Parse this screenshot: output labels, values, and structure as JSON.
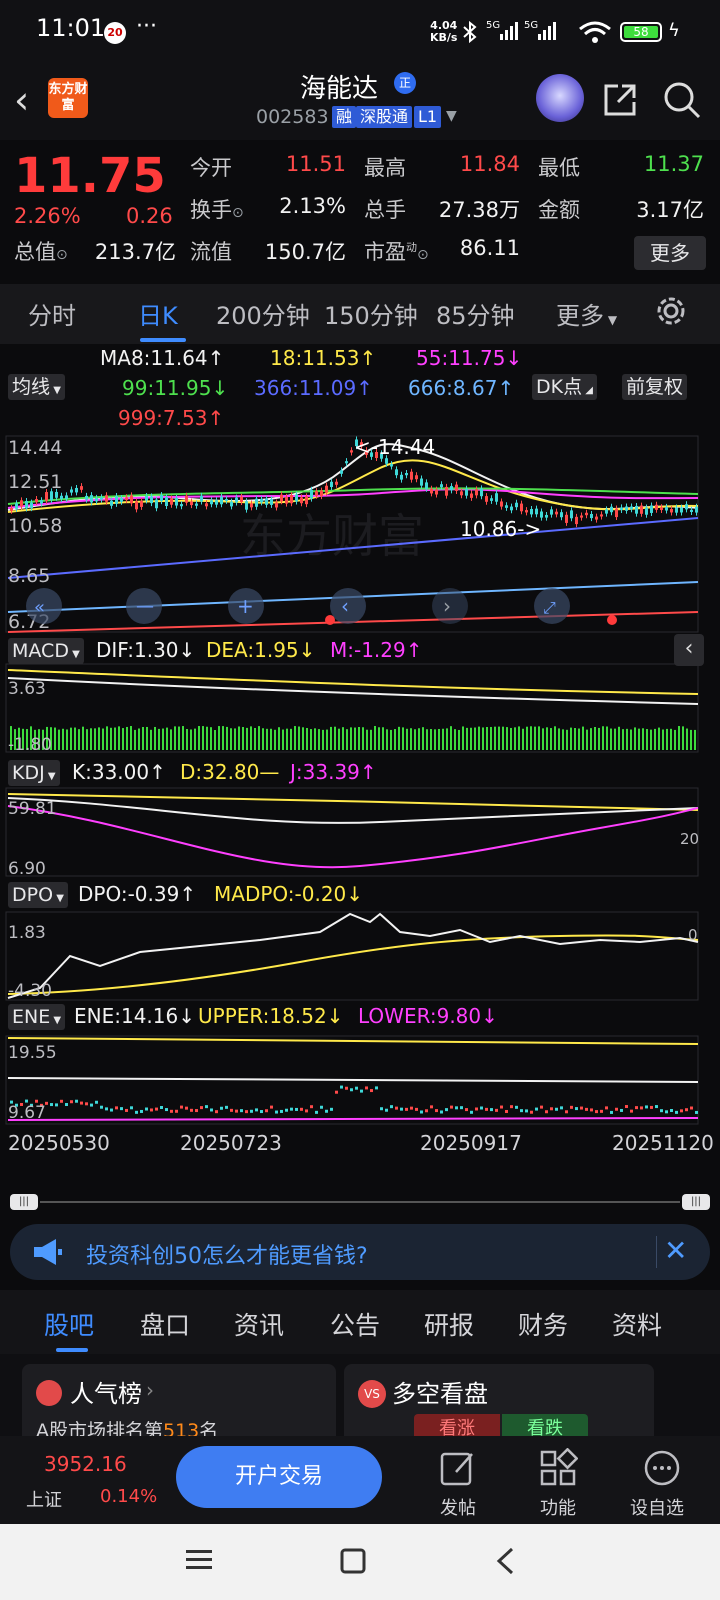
{
  "status": {
    "time": "11:01",
    "notif_badge": "20",
    "more": "···",
    "speed_top": "4.04",
    "speed_bottom": "KB/s",
    "network": "5G 5G",
    "battery": "58"
  },
  "header": {
    "app_logo": "东方财富",
    "stock_name": "海能达",
    "name_badge": "正",
    "stock_code": "002583",
    "tags": [
      "融",
      "深股通",
      "L1"
    ]
  },
  "quote": {
    "price": "11.75",
    "pct": "2.26%",
    "change": "0.26",
    "open_label": "今开",
    "open": "11.51",
    "high_label": "最高",
    "high": "11.84",
    "low_label": "最低",
    "low": "11.37",
    "turnover_label": "换手",
    "turnover": "2.13%",
    "volume_label": "总手",
    "volume": "27.38万",
    "amount_label": "金额",
    "amount": "3.17亿",
    "mcap_label": "总值",
    "mcap": "213.7亿",
    "float_label": "流值",
    "float": "150.7亿",
    "pe_label": "市盈",
    "pe_sup": "动",
    "pe": "86.11",
    "more_button": "更多"
  },
  "chart_tabs": [
    "分时",
    "日K",
    "200分钟",
    "150分钟",
    "85分钟",
    "更多"
  ],
  "main_chart": {
    "indicator_button": "均线",
    "ma_lines": [
      {
        "text": "MA8:11.64↑",
        "color": "#f2f2f2"
      },
      {
        "text": "18:11.53↑",
        "color": "#ffe94a"
      },
      {
        "text": "55:11.75↓",
        "color": "#ff40ff"
      },
      {
        "text": "99:11.95↓",
        "color": "#4ee04e"
      },
      {
        "text": "366:11.09↑",
        "color": "#5b6bff"
      },
      {
        "text": "666:8.67↑",
        "color": "#6fb6ff"
      },
      {
        "text": "999:7.53↑",
        "color": "#ff4a4a"
      }
    ],
    "dk_button": "DK点",
    "adjust_button": "前复权",
    "y_labels": [
      "14.44",
      "12.51",
      "10.58",
      "8.65",
      "6.72"
    ],
    "max_marker": "<-14.44",
    "min_marker": "10.86->",
    "watermark": "东方财富"
  },
  "macd": {
    "button": "MACD",
    "dif": "DIF:1.30↓",
    "dea": "DEA:1.95↓",
    "m": "M:-1.29↑",
    "y_top": "3.63",
    "y_bottom": "-1.80"
  },
  "kdj": {
    "button": "KDJ",
    "k": "K:33.00↑",
    "d": "D:32.80—",
    "j": "J:33.39↑",
    "y_top": "59.81",
    "y_bottom": "6.90",
    "y_right": "20"
  },
  "dpo": {
    "button": "DPO",
    "dpo": "DPO:-0.39↑",
    "madpo": "MADPO:-0.20↓",
    "y_top": "1.83",
    "y_bottom": "-4.30",
    "y_right": "0"
  },
  "ene": {
    "button": "ENE",
    "ene": "ENE:14.16↓",
    "upper": "UPPER:18.52↓",
    "lower": "LOWER:9.80↓",
    "y_top": "19.55",
    "y_bottom": "9.67"
  },
  "dates": [
    "20250530",
    "20250723",
    "20250917",
    "20251120"
  ],
  "banner": {
    "text": "投资科创50怎么才能更省钱?"
  },
  "info_tabs": [
    "股吧",
    "盘口",
    "资讯",
    "公告",
    "研报",
    "财务",
    "资料"
  ],
  "cards": {
    "left_title": "人气榜",
    "left_sub_prefix": "A股市场排名第",
    "left_rank": "513",
    "left_sub_suffix": "名",
    "right_title": "多空看盘",
    "bull": "看涨",
    "bear": "看跌"
  },
  "bottom_bar": {
    "index_value": "3952.16",
    "index_name": "上证",
    "index_pct": "0.14%",
    "trade_button": "开户交易",
    "post": "发帖",
    "function": "功能",
    "watchlist": "设自选"
  }
}
